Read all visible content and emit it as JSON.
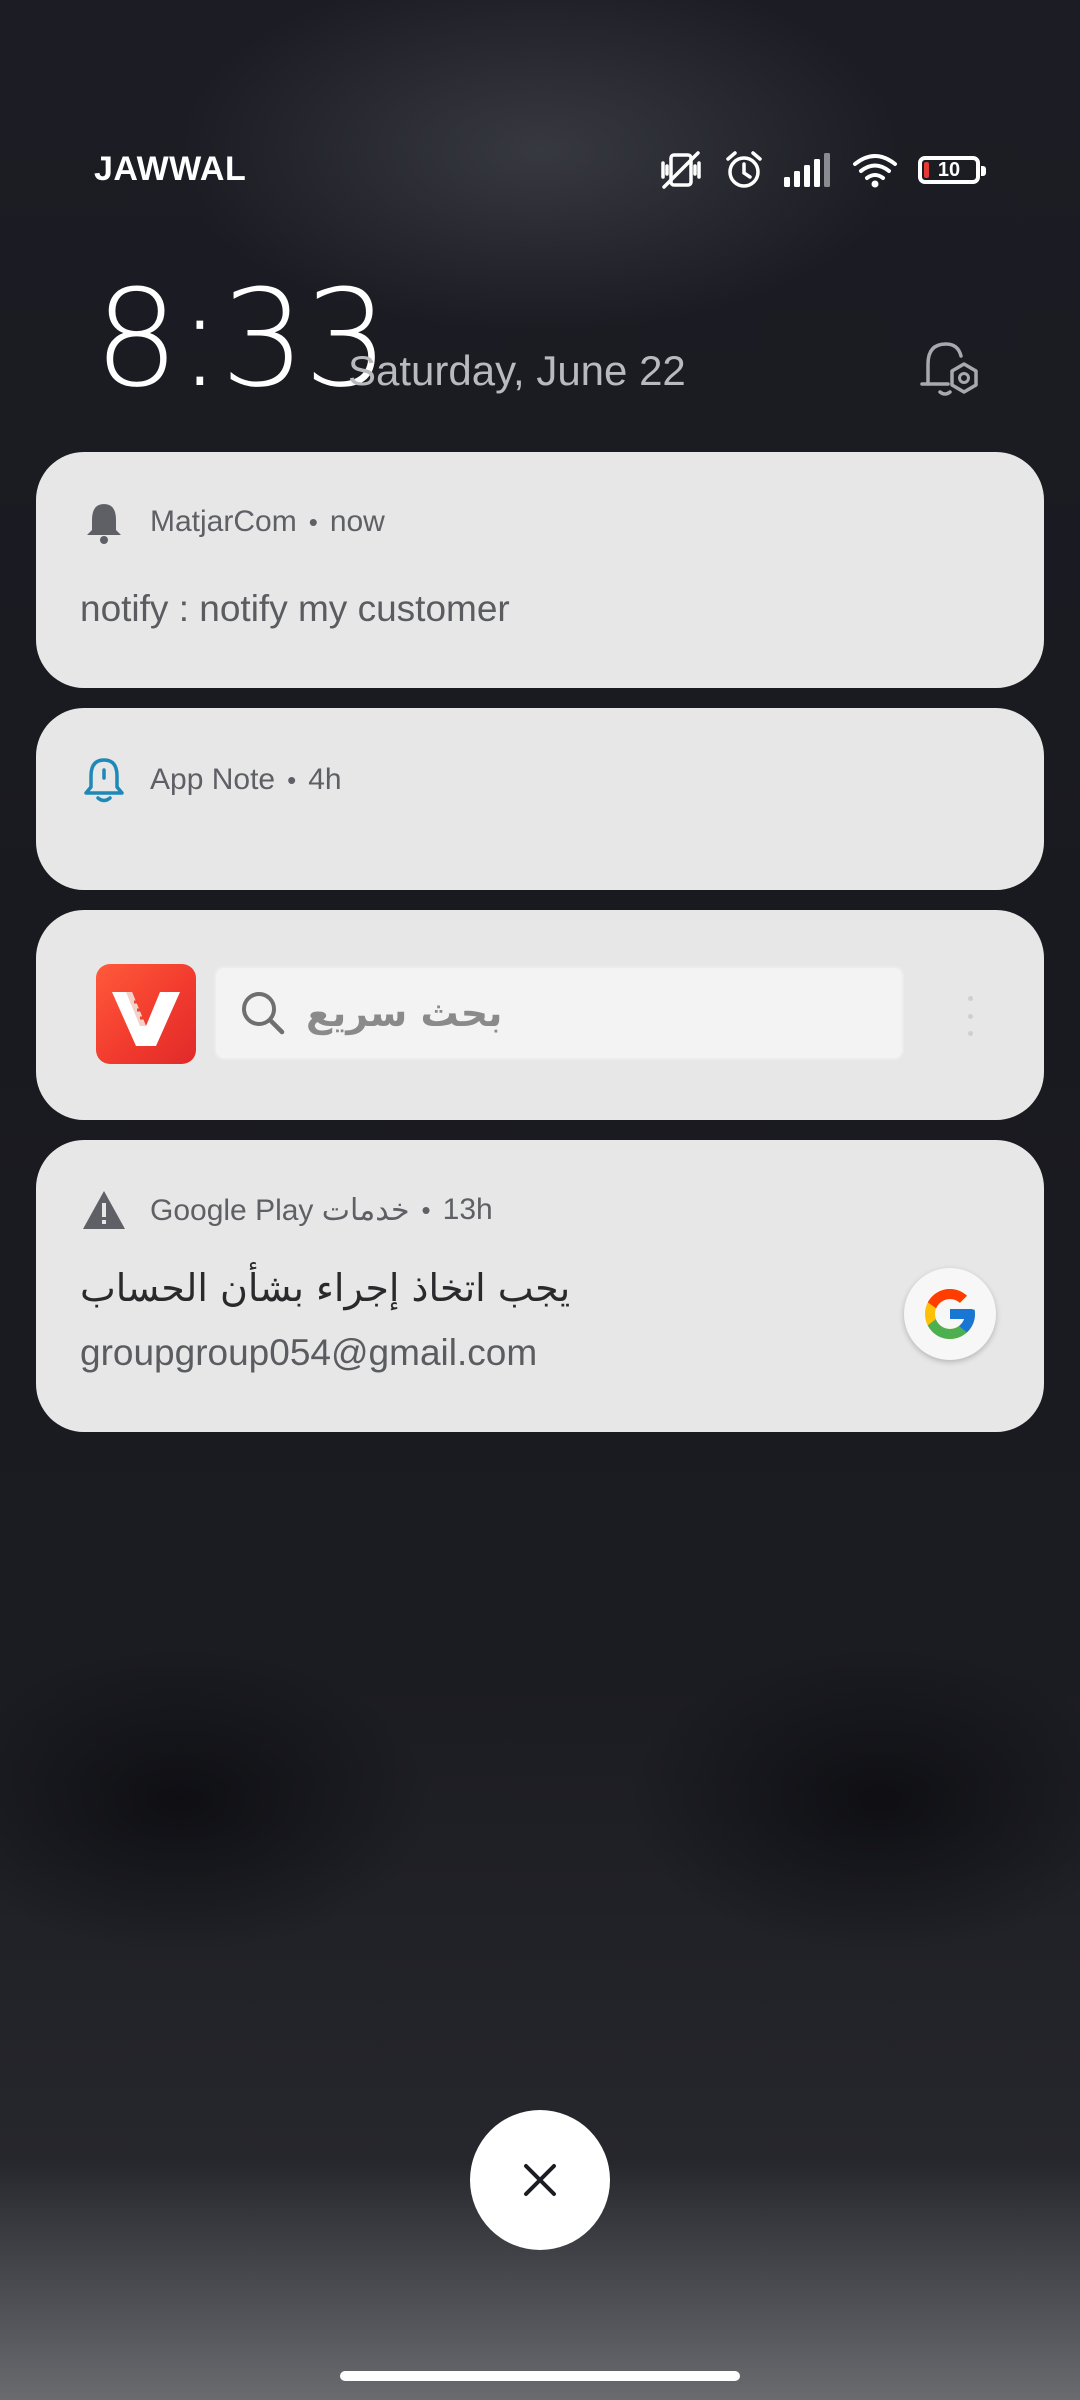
{
  "status_bar": {
    "carrier": "JAWWAL",
    "battery_level": "10",
    "battery_fraction": 0.1,
    "icons": [
      "vibrate-off-icon",
      "alarm-icon",
      "signal-icon",
      "wifi-icon",
      "battery-icon"
    ]
  },
  "lockscreen": {
    "time": "8:33",
    "date": "Saturday, June 22"
  },
  "notifications": [
    {
      "app": "MatjarCom",
      "time": "now",
      "body": "notify : notify my customer",
      "icon": "bell-icon"
    },
    {
      "app": "App Note",
      "time": "4h",
      "icon": "bell-outline-icon"
    },
    {
      "widget": "search-widget",
      "app_icon": "vidmate-logo",
      "search_placeholder": "بحث سريع"
    },
    {
      "app": "Google Play خدمات",
      "time": "13h",
      "title": "يجب اتخاذ إجراء بشأن الحساب",
      "body": "groupgroup054@gmail.com",
      "icon": "warning-icon",
      "badge": "google-logo"
    }
  ],
  "separator": "•",
  "colors": {
    "card_bg": "#e7e7e7",
    "app_note_blue": "#1e88b8",
    "battery_red": "#e53935",
    "vid_logo_red": "#f23b2e"
  }
}
